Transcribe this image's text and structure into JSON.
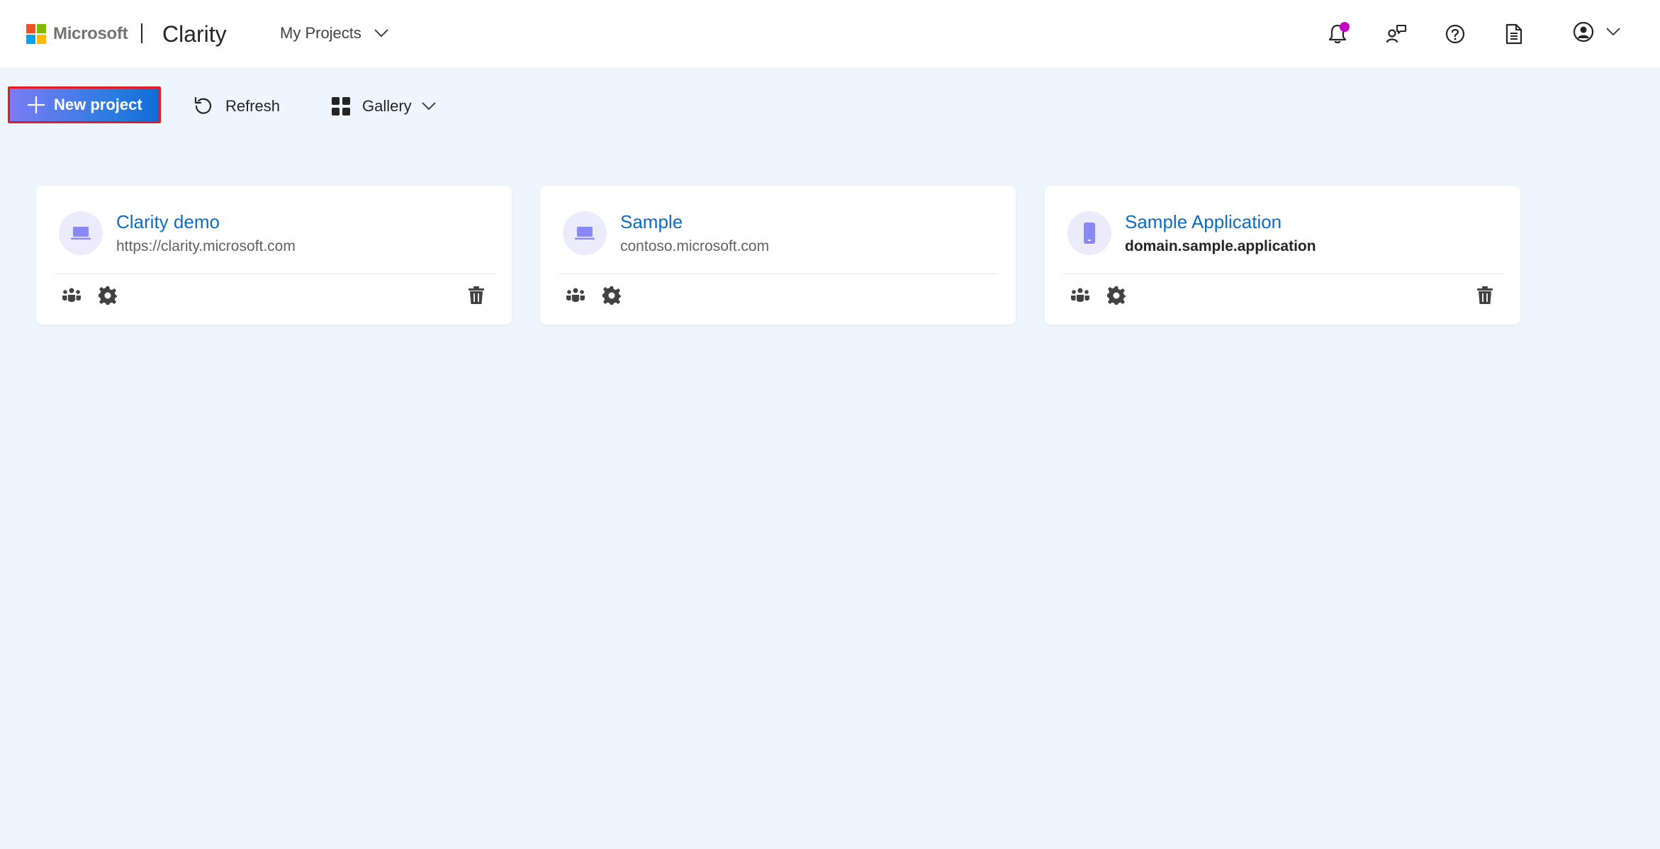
{
  "header": {
    "brand": "Microsoft",
    "product": "Clarity",
    "projects_menu_label": "My Projects",
    "notification_dot_color": "#c400c4"
  },
  "toolbar": {
    "new_project_label": "New project",
    "refresh_label": "Refresh",
    "view_label": "Gallery"
  },
  "projects": [
    {
      "name": "Clarity demo",
      "url": "https://clarity.microsoft.com",
      "device_icon": "laptop-icon",
      "deletable": true
    },
    {
      "name": "Sample",
      "url": "contoso.microsoft.com",
      "device_icon": "laptop-icon",
      "deletable": false
    },
    {
      "name": "Sample Application",
      "url": "domain.sample.application",
      "device_icon": "phone-icon",
      "deletable": true
    }
  ],
  "colors": {
    "accent": "#0f6cbd",
    "background": "#eef5fd",
    "avatar_bg": "#ebebfb",
    "device_icon": "#8a88f5"
  },
  "icons": [
    "notification-bell-icon",
    "feedback-icon",
    "help-icon",
    "document-icon",
    "account-icon",
    "chevron-down-icon",
    "plus-icon",
    "refresh-icon",
    "grid-icon",
    "team-icon",
    "settings-icon",
    "trash-icon"
  ]
}
